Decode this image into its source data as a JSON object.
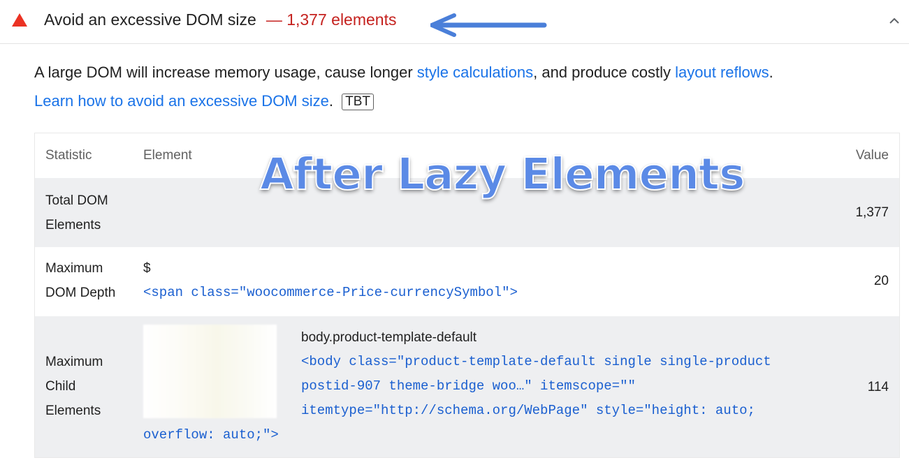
{
  "audit": {
    "title": "Avoid an excessive DOM size",
    "display_value": "— 1,377 elements",
    "status_icon": "fail-triangle-icon",
    "status_color": "#eb3223",
    "display_value_color": "#c5221f"
  },
  "description": {
    "text_1": "A large DOM will increase memory usage, cause longer ",
    "link_1": "style calculations",
    "text_2": ", and produce costly ",
    "link_2": "layout reflows",
    "text_3": ".",
    "learn_link": "Learn how to avoid an excessive DOM size",
    "learn_suffix": ".",
    "tag": "TBT",
    "link_color": "#1a73e8"
  },
  "overlay_heading": "After Lazy Elements",
  "table": {
    "headers": {
      "statistic": "Statistic",
      "element": "Element",
      "value": "Value"
    },
    "rows": [
      {
        "statistic_line1": "Total DOM",
        "statistic_line2": "Elements",
        "value": "1,377"
      },
      {
        "statistic_line1": "Maximum",
        "statistic_line2": "DOM Depth",
        "element_label": "$",
        "element_snippet": "<span class=\"woocommerce-Price-currencySymbol\">",
        "value": "20"
      },
      {
        "statistic_line1": "Maximum",
        "statistic_line2": "Child",
        "statistic_line3": "Elements",
        "element_label": "body.product-template-default",
        "element_snippet_line1": "<body class=\"product-template-default single single-product",
        "element_snippet_line2": "postid-907 theme-bridge woo…\" itemscope=\"\"",
        "element_snippet_line3": "itemtype=\"http://schema.org/WebPage\" style=\"height: auto;",
        "element_snippet_line4": "overflow: auto;\">",
        "value": "114"
      }
    ]
  },
  "icons": {
    "arrow": "left-arrow-icon",
    "chevron": "chevron-up-icon"
  },
  "accent_color": "#4a7fd9"
}
